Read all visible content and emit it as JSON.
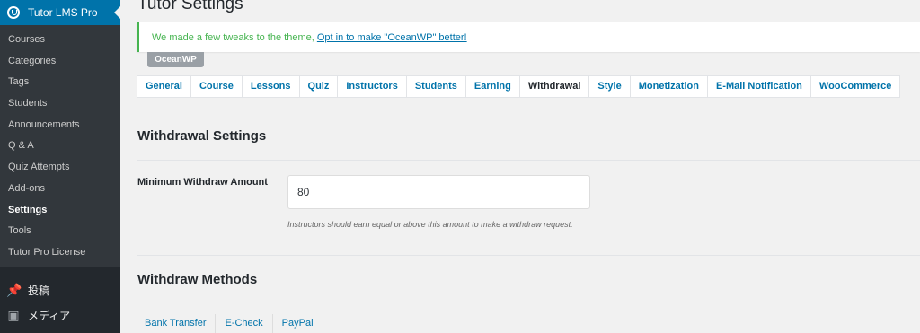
{
  "sidebar": {
    "app_title": "Tutor LMS Pro",
    "submenu": [
      "Courses",
      "Categories",
      "Tags",
      "Students",
      "Announcements",
      "Q & A",
      "Quiz Attempts",
      "Add-ons",
      "Settings",
      "Tools",
      "Tutor Pro License"
    ],
    "active_item": "Settings",
    "menu": [
      {
        "label": "投稿",
        "icon": "pin-icon"
      },
      {
        "label": "メディア",
        "icon": "media-icon"
      }
    ]
  },
  "page": {
    "title": "Tutor Settings"
  },
  "notice": {
    "text": "We made a few tweaks to the theme, ",
    "link": "Opt in to make \"OceanWP\" better!",
    "badge": "OceanWP"
  },
  "tabs": [
    "General",
    "Course",
    "Lessons",
    "Quiz",
    "Instructors",
    "Students",
    "Earning",
    "Withdrawal",
    "Style",
    "Monetization",
    "E-Mail Notification",
    "WooCommerce"
  ],
  "active_tab": "Withdrawal",
  "withdrawal": {
    "section_title": "Withdrawal Settings",
    "min_label": "Minimum Withdraw Amount",
    "min_value": "80",
    "min_help": "Instructors should earn equal or above this amount to make a withdraw request.",
    "methods_title": "Withdraw Methods",
    "methods": [
      "Bank Transfer",
      "E-Check",
      "PayPal"
    ]
  }
}
